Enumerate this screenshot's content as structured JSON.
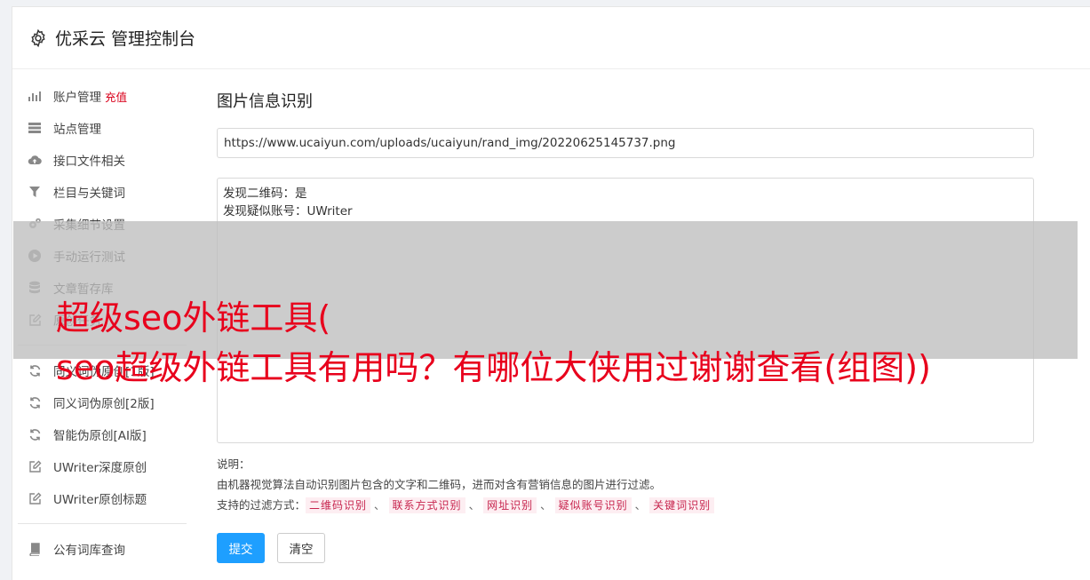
{
  "header": {
    "title": "优采云 管理控制台",
    "icon": "gear-icon"
  },
  "sidebar": {
    "group1": [
      {
        "label": "账户管理",
        "badge": "充值",
        "icon": "bar-chart-icon"
      },
      {
        "label": "站点管理",
        "icon": "server-icon"
      },
      {
        "label": "接口文件相关",
        "icon": "cloud-upload-icon"
      },
      {
        "label": "栏目与关键词",
        "icon": "filter-icon"
      },
      {
        "label": "采集细节设置",
        "icon": "cogs-icon"
      },
      {
        "label": "手动运行测试",
        "icon": "play-circle-icon"
      },
      {
        "label": "文章暂存库",
        "icon": "database-icon"
      },
      {
        "label": "原创任务",
        "icon": "edit-icon"
      }
    ],
    "group2": [
      {
        "label": "同义词伪原创[1版]",
        "icon": "refresh-icon"
      },
      {
        "label": "同义词伪原创[2版]",
        "icon": "refresh-icon"
      },
      {
        "label": "智能伪原创[AI版]",
        "icon": "refresh-icon"
      },
      {
        "label": "UWriter深度原创",
        "icon": "edit-icon"
      },
      {
        "label": "UWriter原创标题",
        "icon": "edit-icon"
      }
    ],
    "group3": [
      {
        "label": "公有词库查询",
        "icon": "book-icon"
      }
    ]
  },
  "main": {
    "title": "图片信息识别",
    "url_value": "https://www.ucaiyun.com/uploads/ucaiyun/rand_img/20220625145737.png",
    "result_lines": [
      "发现二维码：是",
      "发现疑似账号：UWriter"
    ],
    "notes_label": "说明：",
    "notes_desc": "由机器视觉算法自动识别图片包含的文字和二维码，进而对含有营销信息的图片进行过滤。",
    "filters_label": "支持的过滤方式：",
    "filters": [
      "二维码识别",
      "联系方式识别",
      "网址识别",
      "疑似账号识别",
      "关键词识别"
    ],
    "filter_sep": "、",
    "submit_label": "提交",
    "clear_label": "清空"
  },
  "overlay": {
    "line1": "超级seo外链工具(",
    "line2": "seo超级外链工具有用吗？有哪位大侠用过谢谢查看(组图))"
  },
  "colors": {
    "accent": "#1e9fff",
    "danger": "#d9001b",
    "overlay_text": "#e8001c"
  }
}
